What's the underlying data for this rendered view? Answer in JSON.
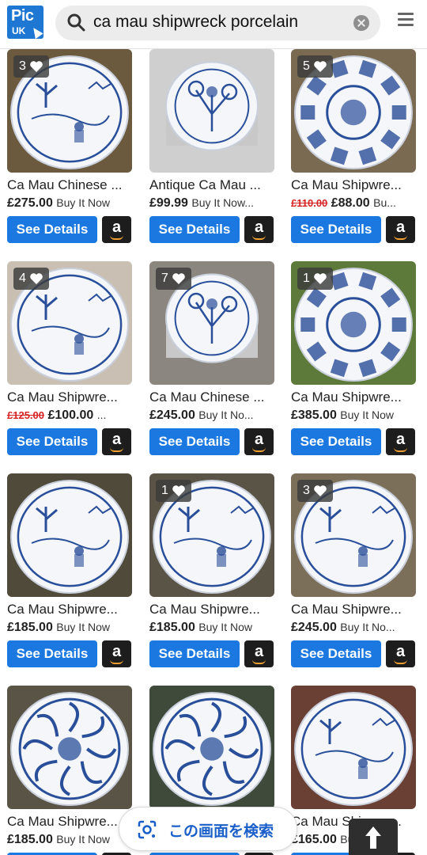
{
  "header": {
    "logo_top": "Pic",
    "logo_bottom": "UK",
    "search_query": "ca mau shipwreck porcelain"
  },
  "products": [
    {
      "title": "Ca Mau Chinese ...",
      "old_price": "",
      "price": "£275.00",
      "shipping": "Buy It Now",
      "likes": "3",
      "details_label": "See Details",
      "amazon_label": "a"
    },
    {
      "title": "Antique Ca Mau ...",
      "old_price": "",
      "price": "£99.99",
      "shipping": "Buy It Now...",
      "likes": "",
      "details_label": "See Details",
      "amazon_label": "a"
    },
    {
      "title": "Ca Mau Shipwre...",
      "old_price": "£110.00",
      "price": "£88.00",
      "shipping": "Bu...",
      "likes": "5",
      "details_label": "See Details",
      "amazon_label": "a"
    },
    {
      "title": "Ca Mau Shipwre...",
      "old_price": "£125.00",
      "price": "£100.00",
      "shipping": "...",
      "likes": "4",
      "details_label": "See Details",
      "amazon_label": "a"
    },
    {
      "title": "Ca Mau Chinese ...",
      "old_price": "",
      "price": "£245.00",
      "shipping": "Buy It No...",
      "likes": "7",
      "details_label": "See Details",
      "amazon_label": "a"
    },
    {
      "title": "Ca Mau Shipwre...",
      "old_price": "",
      "price": "£385.00",
      "shipping": "Buy It Now",
      "likes": "1",
      "details_label": "See Details",
      "amazon_label": "a"
    },
    {
      "title": "Ca Mau Shipwre...",
      "old_price": "",
      "price": "£185.00",
      "shipping": "Buy It Now",
      "likes": "",
      "details_label": "See Details",
      "amazon_label": "a"
    },
    {
      "title": "Ca Mau Shipwre...",
      "old_price": "",
      "price": "£185.00",
      "shipping": "Buy It Now",
      "likes": "1",
      "details_label": "See Details",
      "amazon_label": "a"
    },
    {
      "title": "Ca Mau Shipwre...",
      "old_price": "",
      "price": "£245.00",
      "shipping": "Buy It No...",
      "likes": "3",
      "details_label": "See Details",
      "amazon_label": "a"
    },
    {
      "title": "Ca Mau Shipwre...",
      "old_price": "",
      "price": "£185.00",
      "shipping": "Buy It Now",
      "likes": "",
      "details_label": "See Details",
      "amazon_label": "a"
    },
    {
      "title": "",
      "old_price": "",
      "price": "",
      "shipping": "",
      "likes": "",
      "details_label": "See Details",
      "amazon_label": "a"
    },
    {
      "title": "Ca Mau Shipwre...",
      "old_price": "",
      "price": "£165.00",
      "shipping": "Buy It Now",
      "likes": "",
      "details_label": "See Details",
      "amazon_label": "a"
    }
  ],
  "lens_search": {
    "label": "この画面を検索"
  },
  "colors": {
    "accent_blue": "#1a78e0",
    "strike_red": "#d62222",
    "amazon_black": "#1d1d1d",
    "porcelain_blue": "#2a4f9a"
  }
}
